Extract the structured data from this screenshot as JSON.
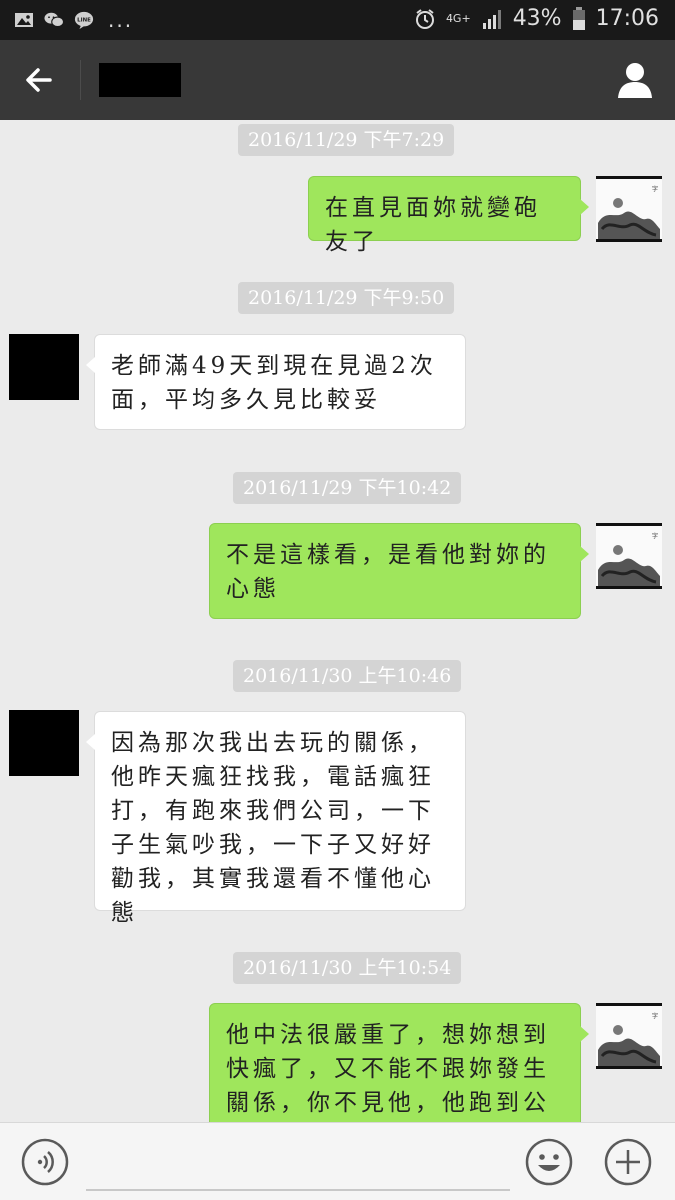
{
  "status_bar": {
    "network": "4G+",
    "battery": "43%",
    "time": "17:06",
    "notification_overflow": "...",
    "left_icons": [
      "gallery-icon",
      "wechat-icon",
      "line-icon"
    ],
    "right_icons": [
      "alarm-icon",
      "signal-icon",
      "battery-icon"
    ]
  },
  "header": {
    "title": "",
    "title_redacted": true,
    "back_icon": "arrow-left-icon",
    "profile_icon": "person-icon"
  },
  "messages": [
    {
      "timestamp": "2016/11/29 下午7:29"
    },
    {
      "sender": "me",
      "text": "在直見面妳就變砲友了"
    },
    {
      "timestamp": "2016/11/29 下午9:50"
    },
    {
      "sender": "them",
      "text": "老師滿49天到現在見過2次面，平均多久見比較妥"
    },
    {
      "timestamp": "2016/11/29 下午10:42"
    },
    {
      "sender": "me",
      "text": "不是這樣看，是看他對妳的心態"
    },
    {
      "timestamp": "2016/11/30 上午10:46"
    },
    {
      "sender": "them",
      "text": "因為那次我出去玩的關係，他昨天瘋狂找我，電話瘋狂打，有跑來我們公司，一下子生氣吵我，一下子又好好勸我，其實我還看不懂他心態"
    },
    {
      "timestamp": "2016/11/30 上午10:54"
    },
    {
      "sender": "me",
      "text": "他中法很嚴重了，想妳想到快瘋了，又不能不跟妳發生關係，你不見他，他跑到公司找"
    }
  ],
  "input_bar": {
    "placeholder": "",
    "voice_icon": "voice-icon",
    "emoji_icon": "emoji-icon",
    "plus_icon": "plus-icon"
  },
  "colors": {
    "status_bar_bg": "#191919",
    "header_bg": "#383838",
    "chat_bg": "#ebebeb",
    "my_bubble": "#9fe65c",
    "their_bubble": "#ffffff",
    "timestamp_bg": "#d4d4d4"
  }
}
